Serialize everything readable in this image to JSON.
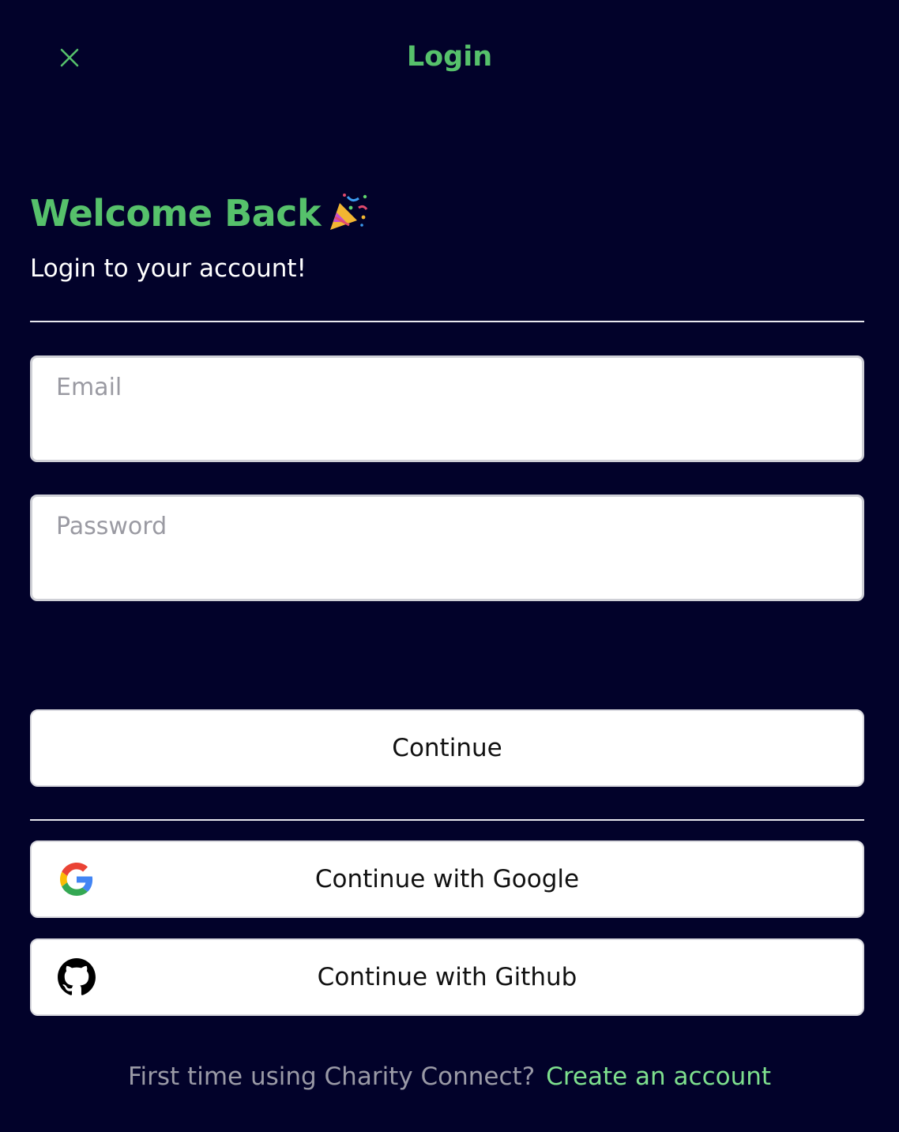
{
  "header": {
    "title": "Login",
    "close_icon": "close-icon"
  },
  "welcome": {
    "title": "Welcome Back",
    "emoji": "🎉",
    "subtitle": "Login to your account!"
  },
  "form": {
    "email_placeholder": "Email",
    "password_placeholder": "Password",
    "continue_label": "Continue"
  },
  "social": {
    "google_label": "Continue with Google",
    "github_label": "Continue with Github"
  },
  "footer": {
    "prompt": "First time using Charity Connect?",
    "link": "Create an account"
  },
  "colors": {
    "background": "#02022a",
    "accent": "#56c16b",
    "link": "#7ee08e"
  }
}
